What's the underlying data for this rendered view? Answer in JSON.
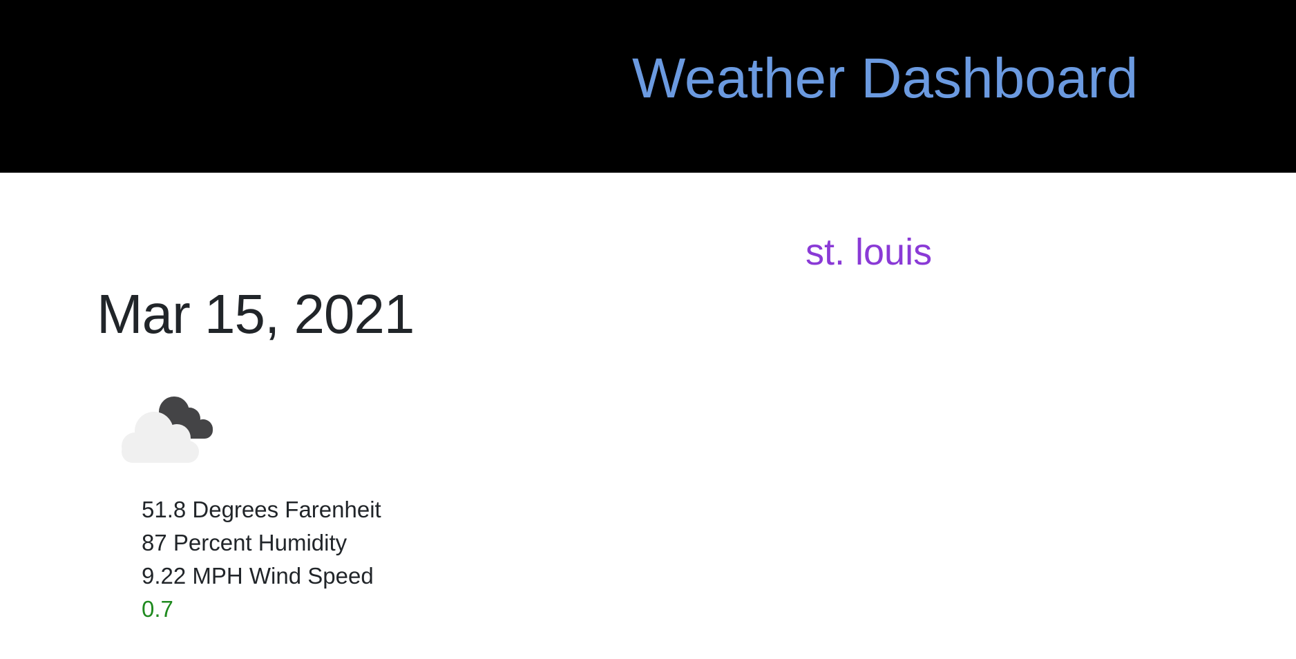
{
  "header": {
    "title": "Weather Dashboard"
  },
  "location": {
    "city": "st. louis"
  },
  "current": {
    "date": "Mar 15, 2021",
    "icon": "cloudy-icon",
    "temperature": "51.8 Degrees Farenheit",
    "humidity": "87 Percent Humidity",
    "wind_speed": "9.22 MPH Wind Speed",
    "uv_index": "0.7"
  },
  "colors": {
    "header_bg": "#000000",
    "title": "#6b9ae0",
    "city": "#8a3ad6",
    "uv_good": "#1f8a1f"
  }
}
